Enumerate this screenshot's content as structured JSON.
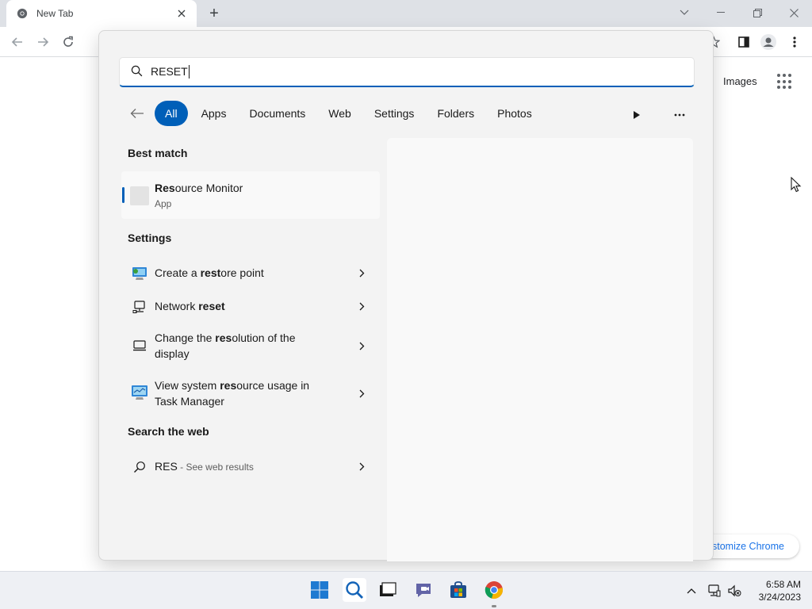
{
  "browser": {
    "tab_title": "New Tab",
    "new_tab_label": "+",
    "ntp": {
      "images_link": "Images",
      "customize_label": "stomize Chrome"
    }
  },
  "search": {
    "query": "RESET",
    "filters": [
      "All",
      "Apps",
      "Documents",
      "Web",
      "Settings",
      "Folders",
      "Photos"
    ],
    "active_filter": "All",
    "best_match": {
      "heading": "Best match",
      "name_bold": "Res",
      "name_rest": "ource Monitor",
      "type": "App"
    },
    "settings_heading": "Settings",
    "settings_items": [
      {
        "pre": "Create a ",
        "bold": "rest",
        "post": "ore point",
        "icon": "restore-point-icon"
      },
      {
        "pre": "Network ",
        "bold": "reset",
        "post": "",
        "icon": "network-icon"
      },
      {
        "pre": "Change the ",
        "bold": "res",
        "post": "olution of the display",
        "icon": "display-icon"
      },
      {
        "pre": "View system ",
        "bold": "res",
        "post": "ource usage in Task Manager",
        "icon": "task-manager-icon"
      }
    ],
    "web_heading": "Search the web",
    "web_item": {
      "query": "RES",
      "suffix": " - See web results"
    }
  },
  "taskbar": {
    "time": "6:58 AM",
    "date": "3/24/2023"
  },
  "colors": {
    "accent": "#005fb8",
    "chrome_link": "#1a73e8"
  }
}
